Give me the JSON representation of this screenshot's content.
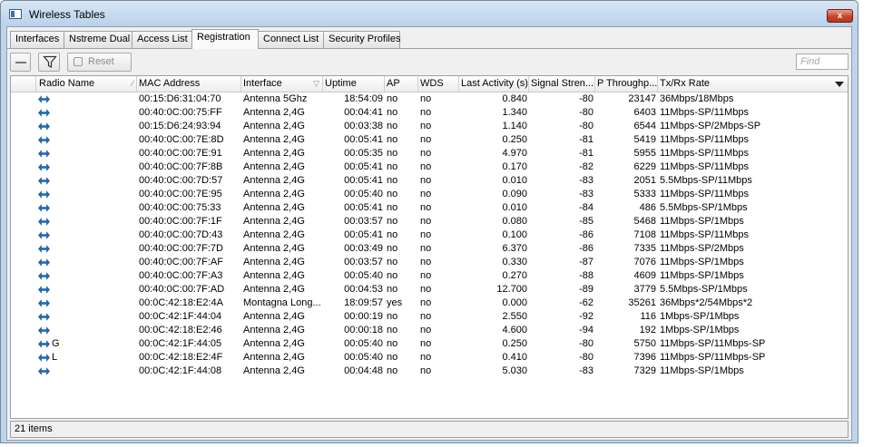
{
  "window": {
    "title": "Wireless Tables",
    "close_glyph": "x"
  },
  "tabs": [
    {
      "label": "Interfaces",
      "active": false
    },
    {
      "label": "Nstreme Dual",
      "active": false
    },
    {
      "label": "Access List",
      "active": false
    },
    {
      "label": "Registration",
      "active": true
    },
    {
      "label": "Connect List",
      "active": false
    },
    {
      "label": "Security Profiles",
      "active": false
    }
  ],
  "toolbar": {
    "reset_label": "Reset",
    "find_placeholder": "Find",
    "icons": [
      "minus-icon",
      "filter-icon",
      "reset-icon"
    ]
  },
  "table": {
    "columns": [
      {
        "key": "radio",
        "label": "Radio Name",
        "sorted": true
      },
      {
        "key": "mac",
        "label": "MAC Address"
      },
      {
        "key": "iface",
        "label": "Interface",
        "sorted": true
      },
      {
        "key": "uptime",
        "label": "Uptime"
      },
      {
        "key": "ap",
        "label": "AP"
      },
      {
        "key": "wds",
        "label": "WDS"
      },
      {
        "key": "activity",
        "label": "Last Activity (s)"
      },
      {
        "key": "signal",
        "label": "Signal Stren..."
      },
      {
        "key": "throughput",
        "label": "P Throughp..."
      },
      {
        "key": "rate",
        "label": "Tx/Rx Rate"
      }
    ],
    "rows": [
      {
        "radio": "",
        "mac": "00:15:D6:31:04:70",
        "iface": "Antenna 5Ghz",
        "uptime": "18:54:09",
        "ap": "no",
        "wds": "no",
        "activity": "0.840",
        "signal": "-80",
        "throughput": "23147",
        "rate": "36Mbps/18Mbps"
      },
      {
        "radio": "",
        "mac": "00:40:0C:00:75:FF",
        "iface": "Antenna 2,4G",
        "uptime": "00:04:41",
        "ap": "no",
        "wds": "no",
        "activity": "1.340",
        "signal": "-80",
        "throughput": "6403",
        "rate": "11Mbps-SP/11Mbps"
      },
      {
        "radio": "",
        "mac": "00:15:D6:24:93:94",
        "iface": "Antenna 2,4G",
        "uptime": "00:03:38",
        "ap": "no",
        "wds": "no",
        "activity": "1.140",
        "signal": "-80",
        "throughput": "6544",
        "rate": "11Mbps-SP/2Mbps-SP"
      },
      {
        "radio": "",
        "mac": "00:40:0C:00:7E:8D",
        "iface": "Antenna 2,4G",
        "uptime": "00:05:41",
        "ap": "no",
        "wds": "no",
        "activity": "0.250",
        "signal": "-81",
        "throughput": "5419",
        "rate": "11Mbps-SP/11Mbps"
      },
      {
        "radio": "",
        "mac": "00:40:0C:00:7E:91",
        "iface": "Antenna 2,4G",
        "uptime": "00:05:35",
        "ap": "no",
        "wds": "no",
        "activity": "4.970",
        "signal": "-81",
        "throughput": "5955",
        "rate": "11Mbps-SP/11Mbps"
      },
      {
        "radio": "",
        "mac": "00:40:0C:00:7F:8B",
        "iface": "Antenna 2,4G",
        "uptime": "00:05:41",
        "ap": "no",
        "wds": "no",
        "activity": "0.170",
        "signal": "-82",
        "throughput": "6229",
        "rate": "11Mbps-SP/11Mbps"
      },
      {
        "radio": "",
        "mac": "00:40:0C:00:7D:57",
        "iface": "Antenna 2,4G",
        "uptime": "00:05:41",
        "ap": "no",
        "wds": "no",
        "activity": "0.010",
        "signal": "-83",
        "throughput": "2051",
        "rate": "5.5Mbps-SP/11Mbps"
      },
      {
        "radio": "",
        "mac": "00:40:0C:00:7E:95",
        "iface": "Antenna 2,4G",
        "uptime": "00:05:40",
        "ap": "no",
        "wds": "no",
        "activity": "0.090",
        "signal": "-83",
        "throughput": "5333",
        "rate": "11Mbps-SP/11Mbps"
      },
      {
        "radio": "",
        "mac": "00:40:0C:00:75:33",
        "iface": "Antenna 2,4G",
        "uptime": "00:05:41",
        "ap": "no",
        "wds": "no",
        "activity": "0.010",
        "signal": "-84",
        "throughput": "486",
        "rate": "5.5Mbps-SP/1Mbps"
      },
      {
        "radio": "",
        "mac": "00:40:0C:00:7F:1F",
        "iface": "Antenna 2,4G",
        "uptime": "00:03:57",
        "ap": "no",
        "wds": "no",
        "activity": "0.080",
        "signal": "-85",
        "throughput": "5468",
        "rate": "11Mbps-SP/1Mbps"
      },
      {
        "radio": "",
        "mac": "00:40:0C:00:7D:43",
        "iface": "Antenna 2,4G",
        "uptime": "00:05:41",
        "ap": "no",
        "wds": "no",
        "activity": "0.100",
        "signal": "-86",
        "throughput": "7108",
        "rate": "11Mbps-SP/11Mbps"
      },
      {
        "radio": "",
        "mac": "00:40:0C:00:7F:7D",
        "iface": "Antenna 2,4G",
        "uptime": "00:03:49",
        "ap": "no",
        "wds": "no",
        "activity": "6.370",
        "signal": "-86",
        "throughput": "7335",
        "rate": "11Mbps-SP/2Mbps"
      },
      {
        "radio": "",
        "mac": "00:40:0C:00:7F:AF",
        "iface": "Antenna 2,4G",
        "uptime": "00:03:57",
        "ap": "no",
        "wds": "no",
        "activity": "0.330",
        "signal": "-87",
        "throughput": "7076",
        "rate": "11Mbps-SP/1Mbps"
      },
      {
        "radio": "",
        "mac": "00:40:0C:00:7F:A3",
        "iface": "Antenna 2,4G",
        "uptime": "00:05:40",
        "ap": "no",
        "wds": "no",
        "activity": "0.270",
        "signal": "-88",
        "throughput": "4609",
        "rate": "11Mbps-SP/1Mbps"
      },
      {
        "radio": "",
        "mac": "00:40:0C:00:7F:AD",
        "iface": "Antenna 2,4G",
        "uptime": "00:04:53",
        "ap": "no",
        "wds": "no",
        "activity": "12.700",
        "signal": "-89",
        "throughput": "3779",
        "rate": "5.5Mbps-SP/1Mbps"
      },
      {
        "radio": "",
        "mac": "00:0C:42:18:E2:4A",
        "iface": "Montagna Long...",
        "uptime": "18:09:57",
        "ap": "yes",
        "wds": "no",
        "activity": "0.000",
        "signal": "-62",
        "throughput": "35261",
        "rate": "36Mbps*2/54Mbps*2"
      },
      {
        "radio": "",
        "mac": "00:0C:42:1F:44:04",
        "iface": "Antenna 2,4G",
        "uptime": "00:00:19",
        "ap": "no",
        "wds": "no",
        "activity": "2.550",
        "signal": "-92",
        "throughput": "116",
        "rate": "1Mbps-SP/1Mbps"
      },
      {
        "radio": "",
        "mac": "00:0C:42:18:E2:46",
        "iface": "Antenna 2,4G",
        "uptime": "00:00:18",
        "ap": "no",
        "wds": "no",
        "activity": "4.600",
        "signal": "-94",
        "throughput": "192",
        "rate": "1Mbps-SP/1Mbps"
      },
      {
        "radio": "G",
        "mac": "00:0C:42:1F:44:05",
        "iface": "Antenna 2,4G",
        "uptime": "00:05:40",
        "ap": "no",
        "wds": "no",
        "activity": "0.250",
        "signal": "-80",
        "throughput": "5750",
        "rate": "11Mbps-SP/11Mbps-SP"
      },
      {
        "radio": "L",
        "mac": "00:0C:42:18:E2:4F",
        "iface": "Antenna 2,4G",
        "uptime": "00:05:40",
        "ap": "no",
        "wds": "no",
        "activity": "0.410",
        "signal": "-80",
        "throughput": "7396",
        "rate": "11Mbps-SP/11Mbps-SP"
      },
      {
        "radio": "",
        "mac": "00:0C:42:1F:44:08",
        "iface": "Antenna 2,4G",
        "uptime": "00:04:48",
        "ap": "no",
        "wds": "no",
        "activity": "5.030",
        "signal": "-83",
        "throughput": "7329",
        "rate": "11Mbps-SP/1Mbps"
      }
    ]
  },
  "status": {
    "item_count": "21 items"
  },
  "colors": {
    "row_icon": "#1f6fbf"
  }
}
